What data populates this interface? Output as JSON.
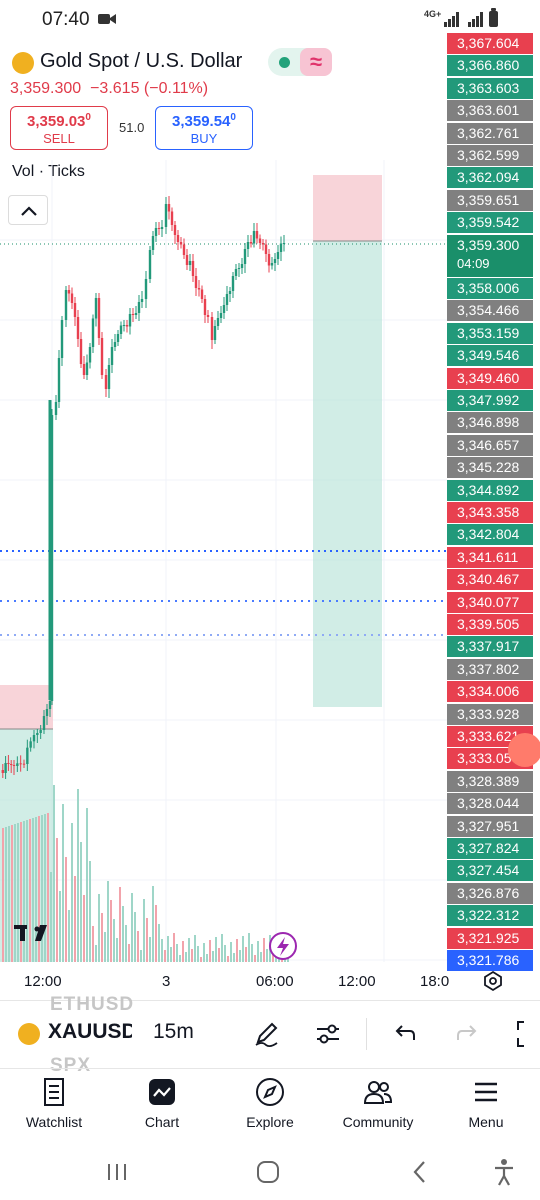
{
  "status": {
    "time": "07:40",
    "network": "4G+"
  },
  "header": {
    "symbol_title": "Gold Spot / U.S. Dollar",
    "last_price": "3,359.300",
    "change": "−3.615",
    "change_pct": "(−0.11%)",
    "sell_price": "3,359.03",
    "sell_price_sup": "0",
    "sell_label": "SELL",
    "buy_price": "3,359.54",
    "buy_price_sup": "0",
    "buy_label": "BUY",
    "spread": "51.0"
  },
  "chart": {
    "volume_label": "Vol · Ticks",
    "colors": {
      "up": "#22997a",
      "down": "#e8404f",
      "neutral": "#808080",
      "current": "#1a8f6a",
      "blue": "#2962ff"
    },
    "price_scale": [
      {
        "text": "3,367.604",
        "color": "down"
      },
      {
        "text": "3,366.860",
        "color": "up"
      },
      {
        "text": "3,363.603",
        "color": "up"
      },
      {
        "text": "3,363.601",
        "color": "neutral"
      },
      {
        "text": "3,362.761",
        "color": "neutral"
      },
      {
        "text": "3,362.599",
        "color": "neutral"
      },
      {
        "text": "3,362.094",
        "color": "up"
      },
      {
        "text": "3,359.651",
        "color": "neutral"
      },
      {
        "text": "3,359.542",
        "color": "up"
      },
      {
        "text": "3,359.300",
        "color": "current",
        "sub": "04:09"
      },
      {
        "text": "3,358.006",
        "color": "up"
      },
      {
        "text": "3,354.466",
        "color": "neutral"
      },
      {
        "text": "3,353.159",
        "color": "up"
      },
      {
        "text": "3,349.546",
        "color": "up"
      },
      {
        "text": "3,349.460",
        "color": "down"
      },
      {
        "text": "3,347.992",
        "color": "up"
      },
      {
        "text": "3,346.898",
        "color": "neutral"
      },
      {
        "text": "3,346.657",
        "color": "neutral"
      },
      {
        "text": "3,345.228",
        "color": "neutral"
      },
      {
        "text": "3,344.892",
        "color": "up"
      },
      {
        "text": "3,343.358",
        "color": "down"
      },
      {
        "text": "3,342.804",
        "color": "up"
      },
      {
        "text": "3,341.611",
        "color": "down"
      },
      {
        "text": "3,340.467",
        "color": "down"
      },
      {
        "text": "3,340.077",
        "color": "down"
      },
      {
        "text": "3,339.505",
        "color": "down"
      },
      {
        "text": "3,337.917",
        "color": "up"
      },
      {
        "text": "3,337.802",
        "color": "neutral"
      },
      {
        "text": "3,334.006",
        "color": "down"
      },
      {
        "text": "3,333.928",
        "color": "neutral"
      },
      {
        "text": "3,333.621",
        "color": "down"
      },
      {
        "text": "3,333.05",
        "color": "down"
      },
      {
        "text": "3,328.389",
        "color": "neutral"
      },
      {
        "text": "3,328.044",
        "color": "neutral"
      },
      {
        "text": "3,327.951",
        "color": "neutral"
      },
      {
        "text": "3,327.824",
        "color": "up"
      },
      {
        "text": "3,327.454",
        "color": "up"
      },
      {
        "text": "3,326.876",
        "color": "neutral"
      },
      {
        "text": "3,322.312",
        "color": "up"
      },
      {
        "text": "3,321.925",
        "color": "down"
      },
      {
        "text": "3,321.786",
        "color": "blue"
      }
    ],
    "time_axis": [
      "12:00",
      "3",
      "06:00",
      "12:00",
      "18:0"
    ]
  },
  "toolbar": {
    "symbol": "XAUUSD",
    "interval": "15m",
    "ghost_above": "ETHUSD",
    "ghost_below": "SPX"
  },
  "nav": {
    "items": [
      {
        "label": "Watchlist"
      },
      {
        "label": "Chart"
      },
      {
        "label": "Explore"
      },
      {
        "label": "Community"
      },
      {
        "label": "Menu"
      }
    ]
  }
}
